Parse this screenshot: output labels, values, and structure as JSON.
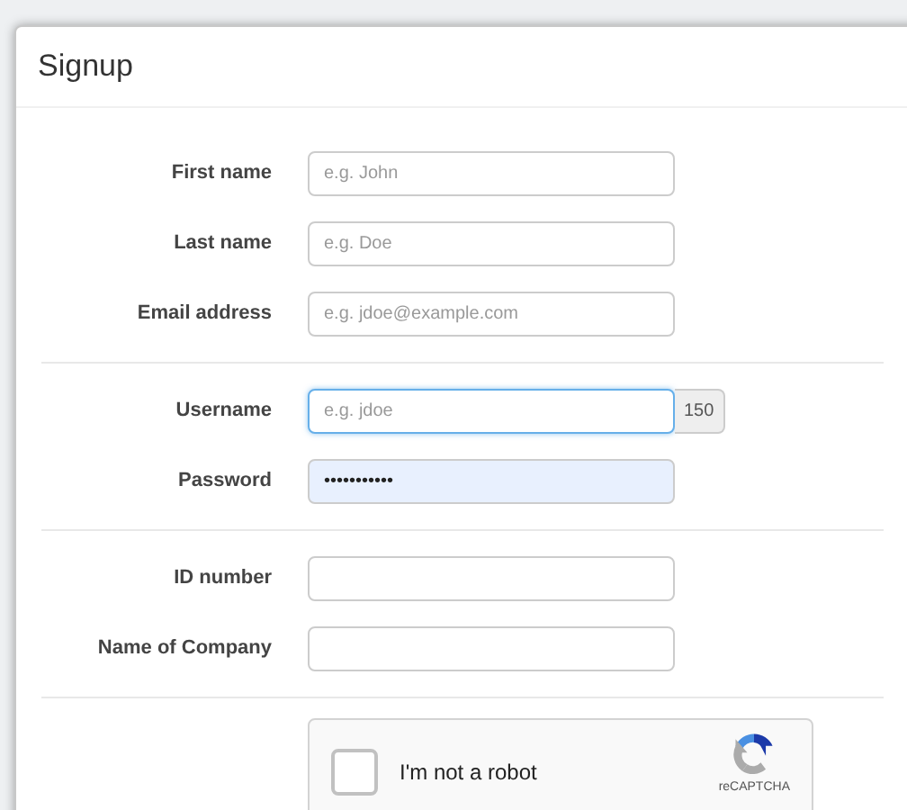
{
  "dialog": {
    "title": "Signup"
  },
  "groups": [
    {
      "fields": [
        {
          "label": "First name",
          "placeholder": "e.g. John",
          "focused": false
        },
        {
          "label": "Last name",
          "placeholder": "e.g. Doe",
          "focused": false
        },
        {
          "label": "Email address",
          "placeholder": "e.g. jdoe@example.com",
          "focused": false
        }
      ]
    },
    {
      "fields": [
        {
          "label": "Username",
          "placeholder": "e.g. jdoe",
          "focused": true,
          "addon": "150"
        },
        {
          "label": "Password",
          "value": "•••••••••••",
          "autofilled": true,
          "focused": false
        }
      ]
    },
    {
      "fields": [
        {
          "label": "ID number",
          "focused": false
        },
        {
          "label": "Name of Company",
          "focused": false
        }
      ]
    }
  ],
  "captcha": {
    "label": "I'm not a robot",
    "checked": false,
    "brand": "reCAPTCHA"
  }
}
